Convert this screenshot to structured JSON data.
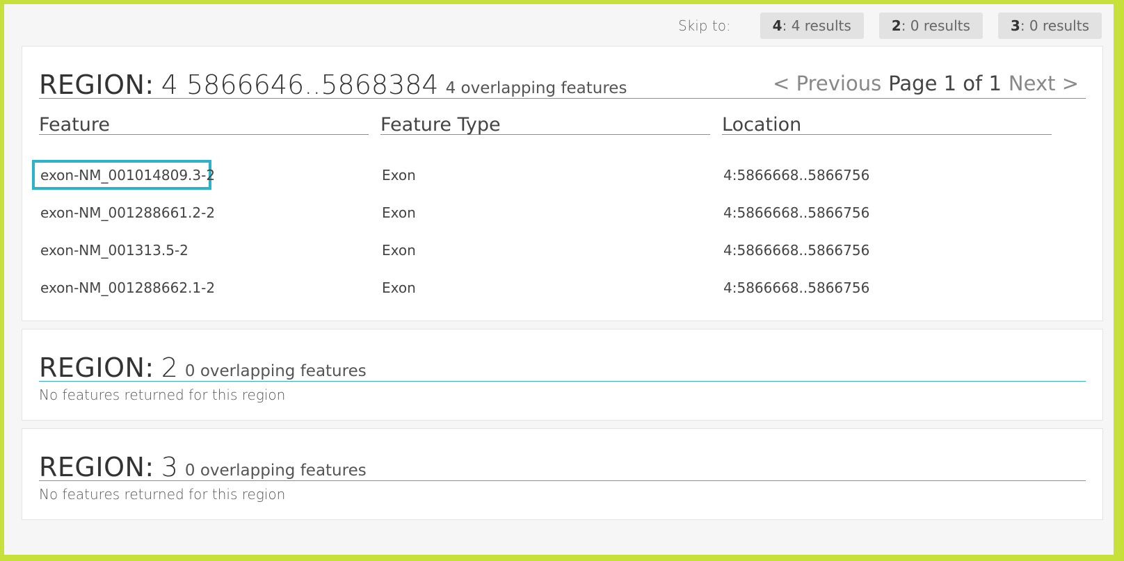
{
  "skip": {
    "label": "Skip to:",
    "buttons": [
      {
        "region": "4",
        "text": ": 4 results"
      },
      {
        "region": "2",
        "text": ": 0 results"
      },
      {
        "region": "3",
        "text": ": 0 results"
      }
    ]
  },
  "regions": [
    {
      "label": "REGION:",
      "value": "4 5866646..5868384",
      "count": "4 overlapping features",
      "pager": {
        "prev": "< Previous",
        "info": "Page 1 of 1",
        "next": "Next >"
      },
      "columns": [
        "Feature",
        "Feature Type",
        "Location"
      ],
      "rows": [
        {
          "feature": "exon-NM_001014809.3-2",
          "type": "Exon",
          "location": "4:5866668..5866756"
        },
        {
          "feature": "exon-NM_001288661.2-2",
          "type": "Exon",
          "location": "4:5866668..5866756"
        },
        {
          "feature": "exon-NM_001313.5-2",
          "type": "Exon",
          "location": "4:5866668..5866756"
        },
        {
          "feature": "exon-NM_001288662.1-2",
          "type": "Exon",
          "location": "4:5866668..5866756"
        }
      ]
    },
    {
      "label": "REGION:",
      "value": "2",
      "count": "0 overlapping features",
      "empty": "No features returned for this region"
    },
    {
      "label": "REGION:",
      "value": "3",
      "count": "0 overlapping features",
      "empty": "No features returned for this region"
    }
  ]
}
